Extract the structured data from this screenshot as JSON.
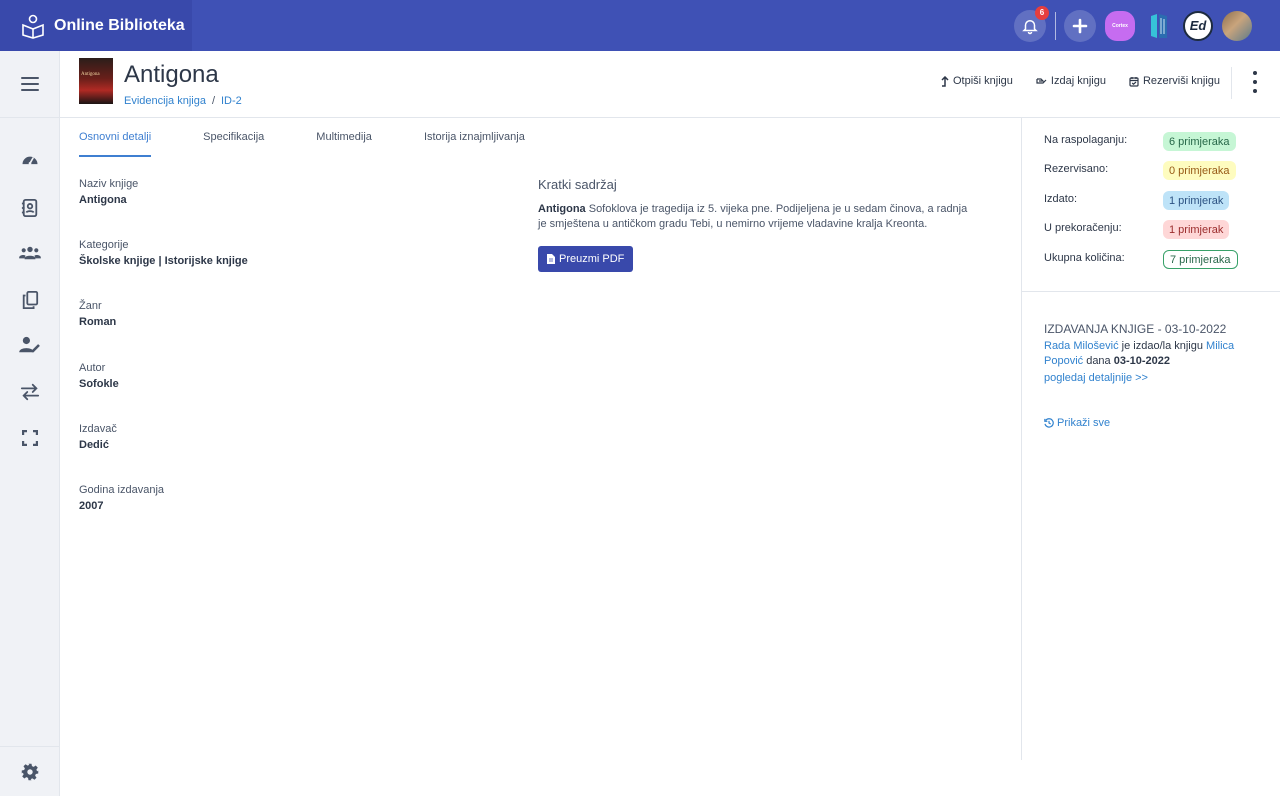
{
  "topbar": {
    "brand": "Online Biblioteka",
    "notification_count": "6",
    "apps": [
      "Cortex",
      "Ed"
    ]
  },
  "header": {
    "cover_text": "Antigona",
    "title": "Antigona",
    "breadcrumb": [
      "Evidencija knjiga",
      "ID-2"
    ],
    "actions": {
      "write_off": "Otpiši knjigu",
      "issue": "Izdaj knjigu",
      "reserve": "Rezerviši knjigu"
    }
  },
  "tabs": [
    "Osnovni detalji",
    "Specifikacija",
    "Multimedija",
    "Istorija iznajmljivanja"
  ],
  "details": [
    {
      "label": "Naziv knjige",
      "value": "Antigona"
    },
    {
      "label": "Kategorije",
      "value": "Školske knjige | Istorijske knjige"
    },
    {
      "label": "Žanr",
      "value": "Roman"
    },
    {
      "label": "Autor",
      "value": "Sofokle"
    },
    {
      "label": "Izdavač",
      "value": "Dedić"
    },
    {
      "label": "Godina izdavanja",
      "value": "2007"
    }
  ],
  "summary": {
    "heading": "Kratki sadržaj",
    "bold": "Antigona",
    "text": " Sofoklova je tragedija iz 5. vijeka pne. Podijeljena je u sedam činova, a radnja je smještena u antičkom gradu Tebi, u nemirno vrijeme vladavine kralja Kreonta.",
    "download_label": "Preuzmi PDF"
  },
  "stats": [
    {
      "label": "Na raspolaganju:",
      "value": "6 primjeraka",
      "color": "#c6f6d5",
      "text_color": "#276749"
    },
    {
      "label": "Rezervisano:",
      "value": "0 primjeraka",
      "color": "#fefcbf",
      "text_color": "#975a16"
    },
    {
      "label": "Izdato:",
      "value": "1 primjerak",
      "color": "#bee3f8",
      "text_color": "#2c5282"
    },
    {
      "label": "U prekoračenju:",
      "value": "1 primjerak",
      "color": "#fed7d7",
      "text_color": "#9b2c2c"
    },
    {
      "label": "Ukupna količina:",
      "value": "7 primjeraka",
      "color": "#ffffff",
      "text_color": "#276749"
    }
  ],
  "issue": {
    "heading": "IZDAVANJA KNJIGE - 03-10-2022",
    "librarian": "Rada Milošević",
    "mid": " je izdao/la knjigu ",
    "student": "Milica Popović",
    "dana": " dana ",
    "date": "03-10-2022",
    "details_link": "pogledaj detaljnije >>"
  },
  "show_all": "Prikaži sve"
}
